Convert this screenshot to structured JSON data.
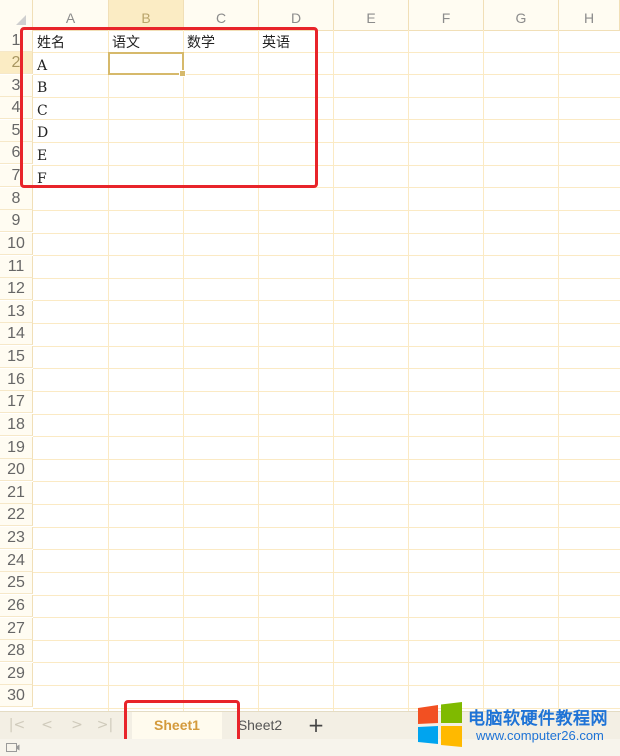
{
  "columns": [
    "A",
    "B",
    "C",
    "D",
    "E",
    "F",
    "G",
    "H"
  ],
  "active_column": "B",
  "rows": [
    "1",
    "2",
    "3",
    "4",
    "5",
    "6",
    "7",
    "8",
    "9",
    "10",
    "11",
    "12",
    "13",
    "14",
    "15",
    "16",
    "17",
    "18",
    "19",
    "20",
    "21",
    "22",
    "23",
    "24",
    "25",
    "26",
    "27",
    "28",
    "29",
    "30"
  ],
  "active_row": "2",
  "cells": {
    "A1": "姓名",
    "B1": "语文",
    "C1": "数学",
    "D1": "英语",
    "A2": "A",
    "A3": "B",
    "A4": "C",
    "A5": "D",
    "A6": "E",
    "A7": "F"
  },
  "selected_cell": "B2",
  "sheet_nav": {
    "first": "|<",
    "prev": "<",
    "next": ">",
    "last": ">|"
  },
  "sheets": [
    {
      "label": "Sheet1",
      "active": true
    },
    {
      "label": "Sheet2",
      "active": false
    }
  ],
  "add_sheet_label": "+",
  "watermark": {
    "title": "电脑软硬件教程网",
    "url": "www.computer26.com"
  },
  "colors": {
    "annotation": "#e8242a",
    "active_tab_text": "#d49a3c",
    "header_bg": "#fffcf2",
    "grid_line": "#fbeac4",
    "watermark_blue": "#1e73d6"
  },
  "icons": {
    "corner": "select-all-triangle-icon",
    "status": "sheet-status-icon"
  }
}
